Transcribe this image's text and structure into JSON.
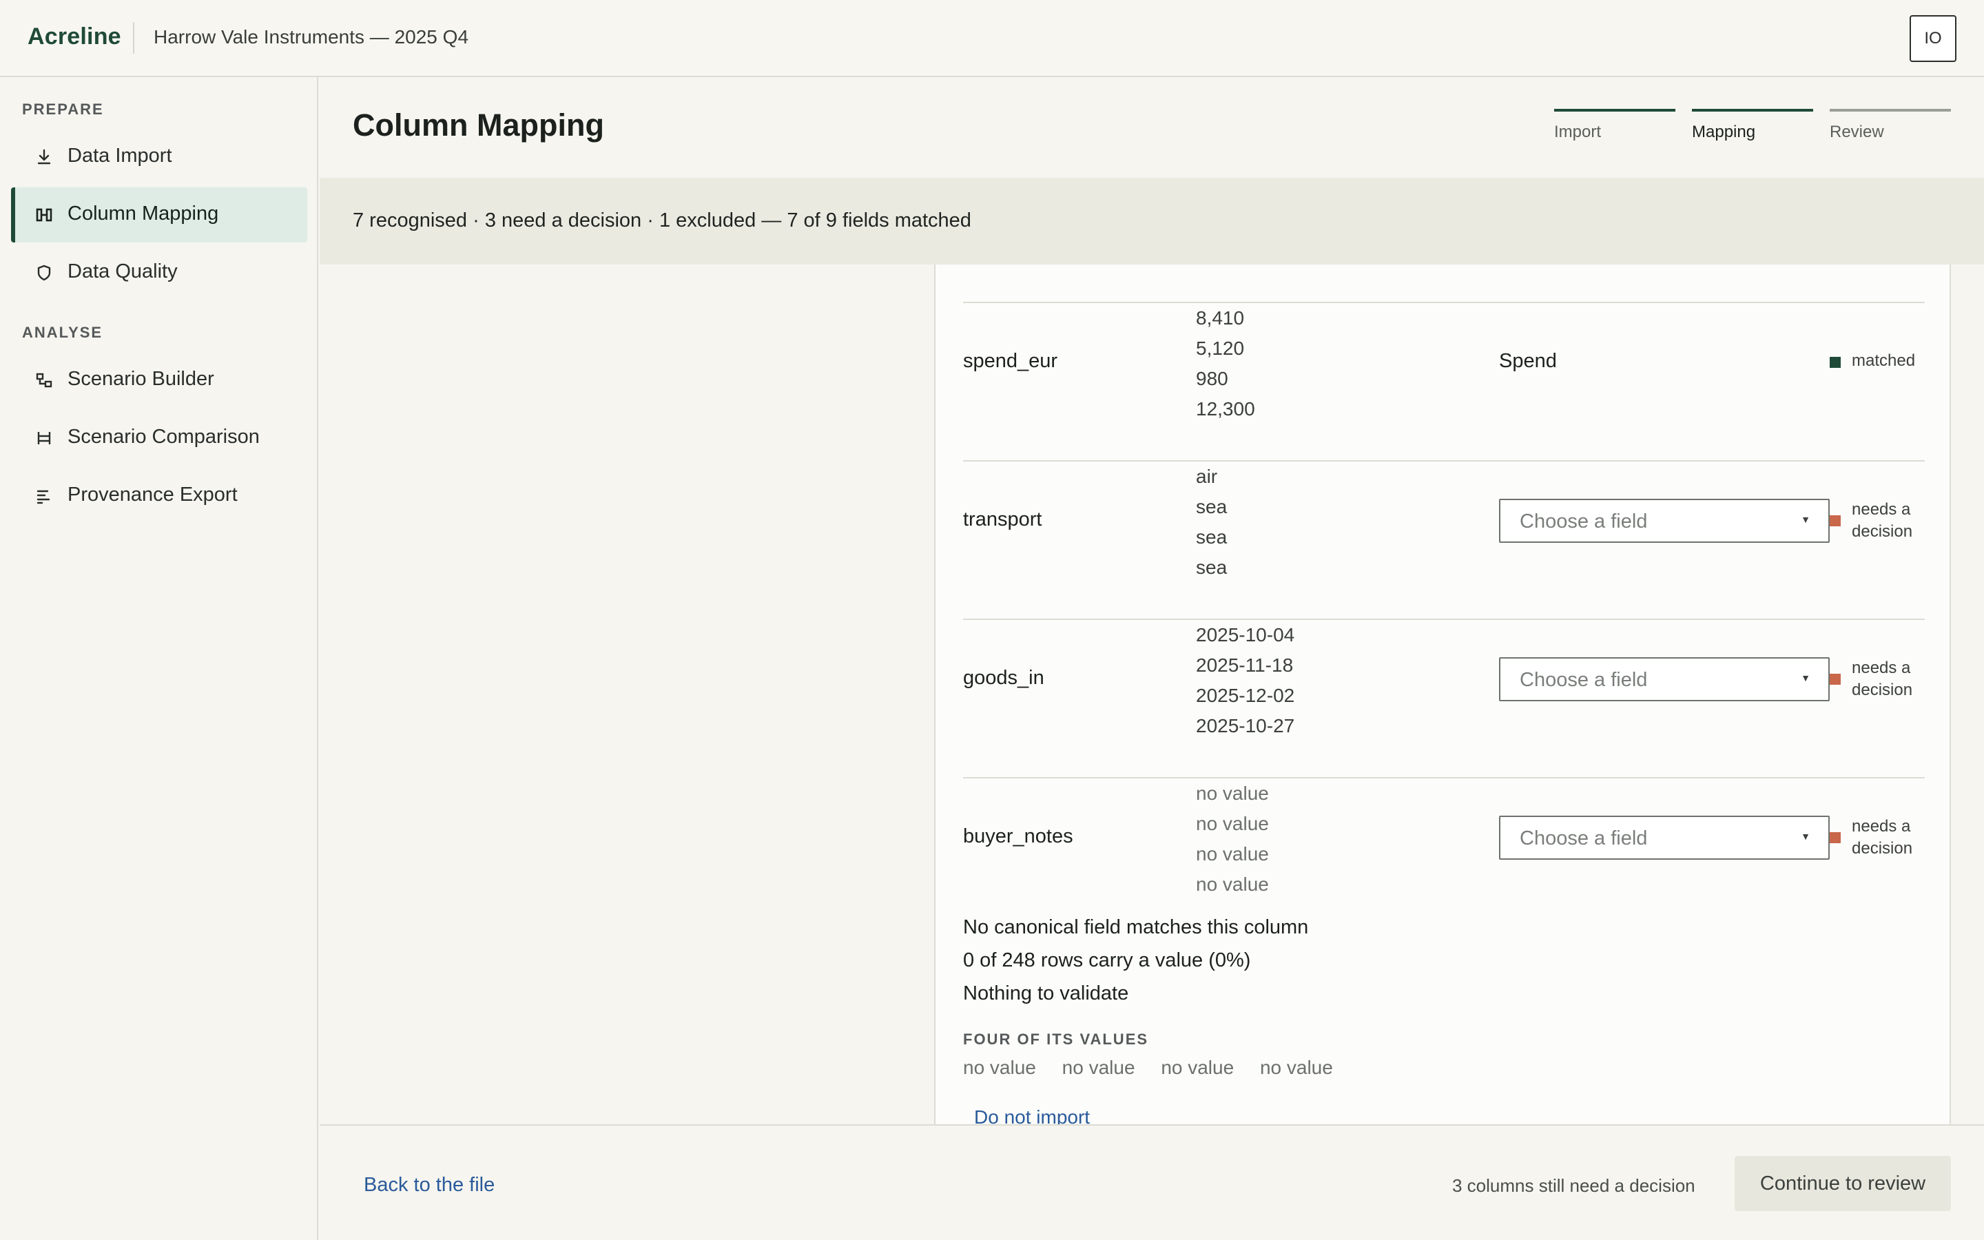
{
  "app": {
    "brand": "Acreline",
    "project": "Harrow Vale Instruments — 2025 Q4",
    "user_initials": "IO"
  },
  "sidebar": {
    "sections": [
      {
        "label": "PREPARE"
      },
      {
        "label": "ANALYSE"
      }
    ],
    "items": [
      {
        "label": "Data Import",
        "icon": "download-icon",
        "active": false
      },
      {
        "label": "Column Mapping",
        "icon": "mapping-icon",
        "active": true
      },
      {
        "label": "Data Quality",
        "icon": "shield-icon",
        "active": false
      },
      {
        "label": "Scenario Builder",
        "icon": "scenario-builder-icon",
        "active": false
      },
      {
        "label": "Scenario Comparison",
        "icon": "compare-icon",
        "active": false
      },
      {
        "label": "Provenance Export",
        "icon": "list-export-icon",
        "active": false
      }
    ]
  },
  "header": {
    "title": "Column Mapping",
    "steps": [
      {
        "label": "Import",
        "state": "complete"
      },
      {
        "label": "Mapping",
        "state": "current"
      },
      {
        "label": "Review",
        "state": "upcoming"
      }
    ]
  },
  "summary": {
    "text": "7 recognised · 3 need a decision · 1 excluded — 7 of 9 fields matched"
  },
  "columns": [
    {
      "name": "spend_eur",
      "samples": [
        "8,410",
        "5,120",
        "980",
        "12,300"
      ],
      "field": "Spend",
      "status": "matched"
    },
    {
      "name": "transport",
      "samples": [
        "air",
        "sea",
        "sea",
        "sea"
      ],
      "field_placeholder": "Choose a field",
      "status": "needs a decision"
    },
    {
      "name": "goods_in",
      "samples": [
        "2025-10-04",
        "2025-11-18",
        "2025-12-02",
        "2025-10-27"
      ],
      "field_placeholder": "Choose a field",
      "status": "needs a decision"
    },
    {
      "name": "buyer_notes",
      "samples": [
        "no value",
        "no value",
        "no value",
        "no value"
      ],
      "field_placeholder": "Choose a field",
      "status": "needs a decision"
    }
  ],
  "detail": {
    "lines": [
      "No canonical field matches this column",
      "0 of 248 rows carry a value (0%)",
      "Nothing to validate"
    ],
    "caption": "FOUR OF ITS VALUES",
    "values": [
      "no value",
      "no value",
      "no value",
      "no value"
    ],
    "action": "Do not import"
  },
  "footer": {
    "back": "Back to the file",
    "pending": "3 columns still need a decision",
    "continue": "Continue to review"
  },
  "colors": {
    "brand": "#1f4a38",
    "matched": "#1f4a38",
    "needs_decision": "#c8674a",
    "link": "#2a5a9a"
  }
}
